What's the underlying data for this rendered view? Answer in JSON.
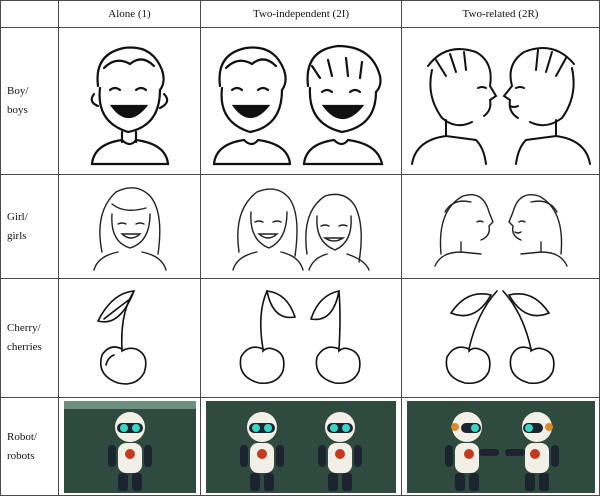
{
  "table": {
    "columns": [
      "",
      "Alone (1)",
      "Two-independent (2I)",
      "Two-related (2R)"
    ],
    "rows": [
      {
        "label_line1": "Boy/",
        "label_line2": "boys"
      },
      {
        "label_line1": "Girl/",
        "label_line2": "girls"
      },
      {
        "label_line1": "Cherry/",
        "label_line2": "cherries"
      },
      {
        "label_line1": "Robot/",
        "label_line2": "robots"
      }
    ]
  },
  "icons": [
    "boy-sketch",
    "girl-sketch",
    "cherry-sketch",
    "robot-photo"
  ],
  "colors": {
    "border": "#4a4a4a",
    "ink": "#111111",
    "robot_background": "#2f4a3e",
    "robot_body": "#f2f0e6",
    "robot_eye": "#39d5c4",
    "robot_badge": "#c33a1f"
  }
}
